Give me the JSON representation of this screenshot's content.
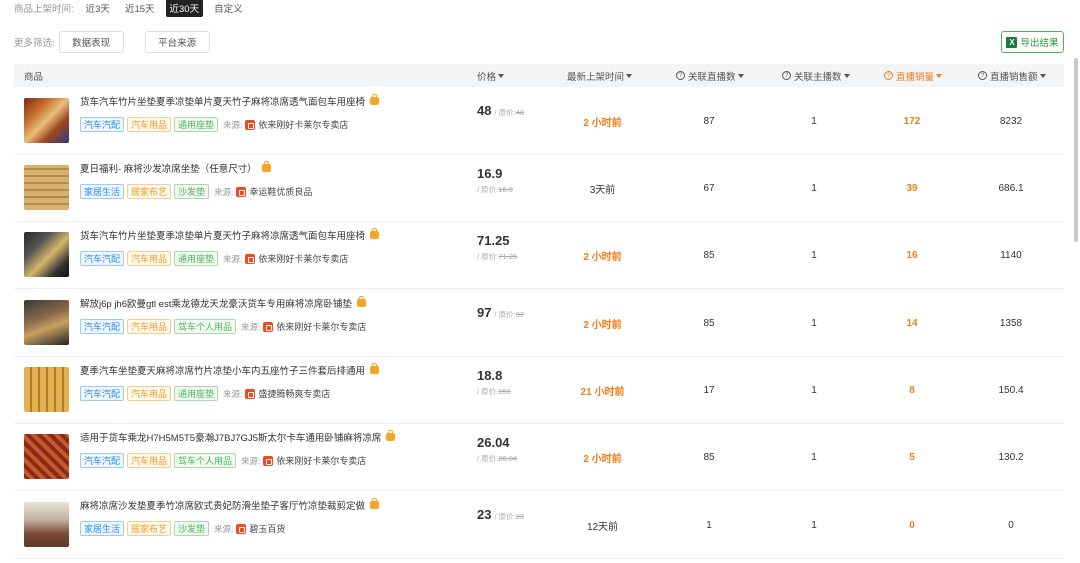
{
  "filters": {
    "time_label": "商品上架时间:",
    "time_options": [
      "近3天",
      "近15天",
      "近30天",
      "自定义"
    ],
    "time_active": "近30天",
    "more_label": "更多筛选:",
    "btn_data": "数据表现",
    "btn_platform": "平台来源",
    "export_label": "导出结果"
  },
  "columns": {
    "product": "商品",
    "price": "价格",
    "latest_time": "最新上架时间",
    "linked_live": "关联直播数",
    "linked_host": "关联主播数",
    "live_sales": "直播销量",
    "live_revenue": "直播销售额"
  },
  "source_label": "来源:",
  "rows": [
    {
      "title": "货车汽车竹片坐垫夏季凉垫单片夏天竹子麻将凉席透气面包车用座椅",
      "tags": [
        {
          "text": "汽车汽配",
          "color": "blue"
        },
        {
          "text": "汽车用品",
          "color": "orange"
        },
        {
          "text": "通用座垫",
          "color": "green"
        }
      ],
      "shop": "依来刚好卡莱尔专卖店",
      "price": "48",
      "orig_price": "48",
      "stacked": false,
      "time": "2 小时前",
      "time_highlight": true,
      "live": "87",
      "hosts": "1",
      "sales": "172",
      "revenue": "8232"
    },
    {
      "title": "夏日福利- 麻将沙发凉席坐垫（任意尺寸）",
      "tags": [
        {
          "text": "家居生活",
          "color": "blue"
        },
        {
          "text": "居家布艺",
          "color": "orange"
        },
        {
          "text": "沙发垫",
          "color": "green"
        }
      ],
      "shop": "幸运鞋优质良品",
      "price": "16.9",
      "orig_price": "16.9",
      "stacked": true,
      "time": "3天前",
      "time_highlight": false,
      "live": "67",
      "hosts": "1",
      "sales": "39",
      "revenue": "686.1"
    },
    {
      "title": "货车汽车竹片坐垫夏季凉垫单片夏天竹子麻将凉席透气面包车用座椅",
      "tags": [
        {
          "text": "汽车汽配",
          "color": "blue"
        },
        {
          "text": "汽车用品",
          "color": "orange"
        },
        {
          "text": "通用座垫",
          "color": "green"
        }
      ],
      "shop": "依来刚好卡莱尔专卖店",
      "price": "71.25",
      "orig_price": "71.25",
      "stacked": true,
      "time": "2 小时前",
      "time_highlight": true,
      "live": "85",
      "hosts": "1",
      "sales": "16",
      "revenue": "1140"
    },
    {
      "title": "解放j6p jh6欧曼gtl est乘龙德龙天龙豪沃货车专用麻将凉席卧铺垫",
      "tags": [
        {
          "text": "汽车汽配",
          "color": "blue"
        },
        {
          "text": "汽车用品",
          "color": "orange"
        },
        {
          "text": "驾车个人用品",
          "color": "green"
        }
      ],
      "shop": "依来刚好卡莱尔专卖店",
      "price": "97",
      "orig_price": "97",
      "stacked": false,
      "time": "2 小时前",
      "time_highlight": true,
      "live": "85",
      "hosts": "1",
      "sales": "14",
      "revenue": "1358"
    },
    {
      "title": "夏季汽车坐垫夏天麻将凉席竹片凉垫小车内五座竹子三件套后排通用",
      "tags": [
        {
          "text": "汽车汽配",
          "color": "blue"
        },
        {
          "text": "汽车用品",
          "color": "orange"
        },
        {
          "text": "通用座垫",
          "color": "green"
        }
      ],
      "shop": "盛捷腾畅爽专卖店",
      "price": "18.8",
      "orig_price": "158",
      "stacked": true,
      "time": "21 小时前",
      "time_highlight": true,
      "live": "17",
      "hosts": "1",
      "sales": "8",
      "revenue": "150.4"
    },
    {
      "title": "适用于货车乘龙H7H5M5T5豪瀚J7BJ7GJ5斯太尔卡车通用卧铺麻将凉席",
      "tags": [
        {
          "text": "汽车汽配",
          "color": "blue"
        },
        {
          "text": "汽车用品",
          "color": "orange"
        },
        {
          "text": "驾车个人用品",
          "color": "green"
        }
      ],
      "shop": "依来刚好卡莱尔专卖店",
      "price": "26.04",
      "orig_price": "26.04",
      "stacked": true,
      "time": "2 小时前",
      "time_highlight": true,
      "live": "85",
      "hosts": "1",
      "sales": "5",
      "revenue": "130.2"
    },
    {
      "title": "麻将凉席沙发垫夏季竹凉席欧式贵妃防滑坐垫子客厅竹凉垫裁剪定做",
      "tags": [
        {
          "text": "家居生活",
          "color": "blue"
        },
        {
          "text": "居家布艺",
          "color": "orange"
        },
        {
          "text": "沙发垫",
          "color": "green"
        }
      ],
      "shop": "碧玉百货",
      "price": "23",
      "orig_price": "23",
      "stacked": false,
      "time": "12天前",
      "time_highlight": false,
      "live": "1",
      "hosts": "1",
      "sales": "0",
      "revenue": "0"
    }
  ],
  "colors": {
    "accent_orange": "#f07d1a",
    "export_green": "#52b45a",
    "active_dark": "#222222"
  },
  "icons": [
    "question-icon",
    "sort-down-icon",
    "shopping-bag-icon",
    "shop-icon",
    "excel-icon"
  ]
}
